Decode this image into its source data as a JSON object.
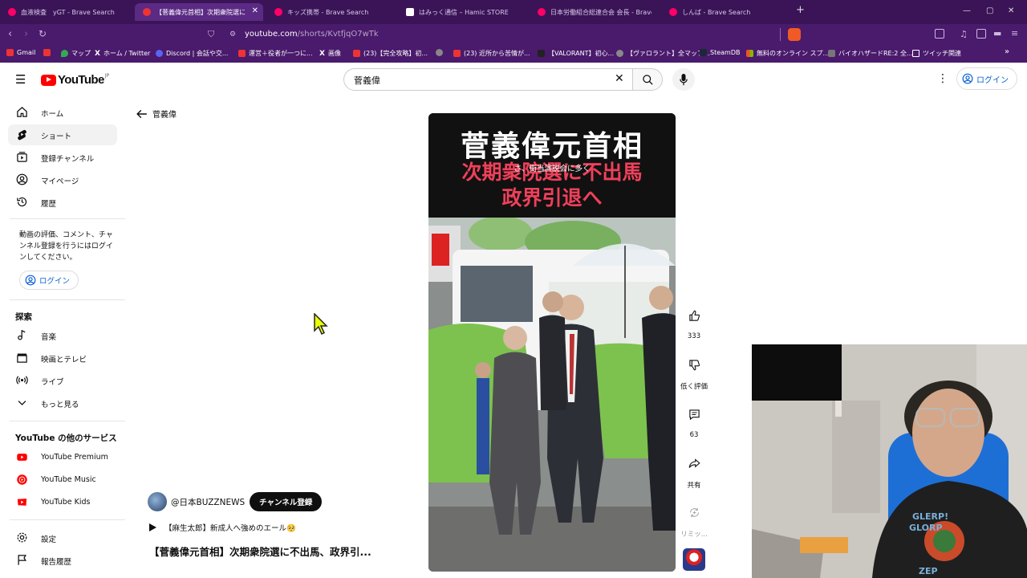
{
  "browser": {
    "tabs": [
      {
        "label": "血液検査　yGT - Brave Search",
        "active": false
      },
      {
        "label": "【菅義偉元首相】次期衆院選に",
        "active": true
      },
      {
        "label": "キッズ携帯 - Brave Search",
        "active": false
      },
      {
        "label": "はみっく通信 – Hamic STORE",
        "active": false
      },
      {
        "label": "日本労働組合総連合会 会長 - Brave",
        "active": false
      },
      {
        "label": "しんば - Brave Search",
        "active": false
      }
    ],
    "new_tab": "+",
    "url_host": "youtube.com",
    "url_path": "/shorts/KvtfjqO7wTk",
    "bookmarks": [
      {
        "label": "Gmail"
      },
      {
        "label": "マップ"
      },
      {
        "label": "ホーム / Twitter"
      },
      {
        "label": "Discord | 会話や交..."
      },
      {
        "label": "運営＋役者が一つに..."
      },
      {
        "label": "画像"
      },
      {
        "label": "(23)【完全攻略】初..."
      },
      {
        "label": ""
      },
      {
        "label": "(23) 近所から苦情が..."
      },
      {
        "label": "【VALORANT】初心..."
      },
      {
        "label": "【ヴァロラント】全マップ..."
      },
      {
        "label": "SteamDB"
      },
      {
        "label": "無料のオンライン スプ..."
      },
      {
        "label": "バイオハザードRE:2 全..."
      },
      {
        "label": "ツイッチ関連"
      }
    ]
  },
  "youtube": {
    "logo_text": "YouTube",
    "logo_region": "JP",
    "search_value": "菅義偉",
    "login_label": "ログイン",
    "sidebar": {
      "items": [
        {
          "label": "ホーム"
        },
        {
          "label": "ショート"
        },
        {
          "label": "登録チャンネル"
        },
        {
          "label": "マイページ"
        },
        {
          "label": "履歴"
        }
      ],
      "login_message": "動画の評価、コメント、チャンネル登録を行うにはログインしてください。",
      "login_button": "ログイン",
      "explore_heading": "探索",
      "explore_items": [
        {
          "label": "音楽"
        },
        {
          "label": "映画とテレビ"
        },
        {
          "label": "ライブ"
        },
        {
          "label": "もっと見る"
        }
      ],
      "services_heading": "YouTube の他のサービス",
      "services": [
        {
          "label": "YouTube Premium"
        },
        {
          "label": "YouTube Music"
        },
        {
          "label": "YouTube Kids"
        }
      ],
      "bottom_items": [
        {
          "label": "設定"
        },
        {
          "label": "報告履歴"
        }
      ]
    },
    "back_label": "菅義偉",
    "short": {
      "overlay_title": "菅義偉元首相",
      "overlay_subtitle_line1": "次期衆院選に不出馬",
      "overlay_subtitle_line2": "政界引退へ",
      "overlay_caption": "さ、街当演説会に多く",
      "likes": "333",
      "dislike_label": "低く評価",
      "comments": "63",
      "share_label": "共有",
      "remix_label": "リミッ...",
      "channel_name": "@日本BUZZNEWS",
      "subscribe_label": "チャンネル登録",
      "next_video": "【麻生太郎】新成人へ強めのエール🥺",
      "video_title": "【菅義偉元首相】次期衆院選に不出馬、政界引..."
    }
  },
  "colors": {
    "tab_bar": "#3a1457",
    "address_bar": "#4a1a6c",
    "yt_red": "#ff0000",
    "link_blue": "#065fd4",
    "overlay_pink": "#f0405a"
  }
}
